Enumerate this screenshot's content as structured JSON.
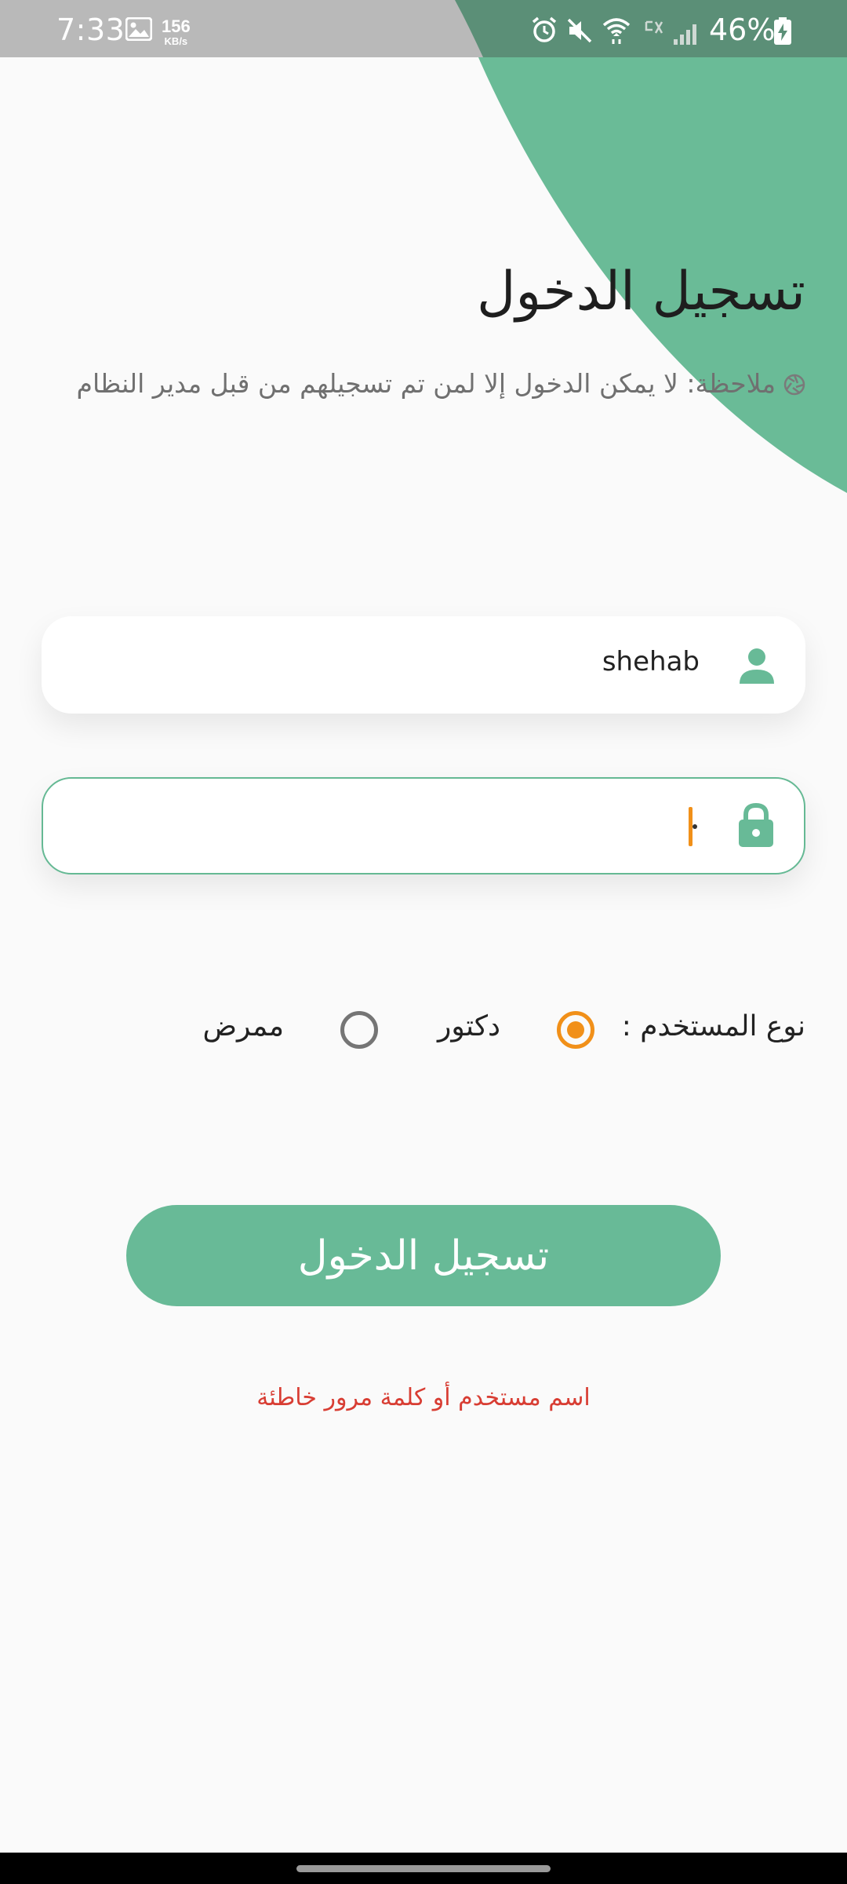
{
  "colors": {
    "accent": "#68ba97",
    "radio_selected": "#f19019",
    "error": "#d83d33",
    "background": "#fafafa"
  },
  "status_bar": {
    "time": "7:33",
    "net_speed_value": "156",
    "net_speed_unit": "KB/s",
    "battery": "46%",
    "icons": [
      "gallery-icon",
      "alarm-icon",
      "mute-icon",
      "wifi-icon",
      "data-off-icon",
      "signal-icon",
      "battery-charging-icon"
    ]
  },
  "header": {
    "title": "تسجيل الدخول",
    "note": "ملاحظة: لا يمكن الدخول إلا لمن تم تسجيلهم من قبل مدير النظام",
    "note_icon": "shutter-icon"
  },
  "form": {
    "username": {
      "value": "shehab",
      "icon": "person-icon"
    },
    "password": {
      "value": "",
      "icon": "lock-icon",
      "focused": true
    },
    "user_type": {
      "label": "نوع المستخدم :",
      "options": [
        {
          "label": "دكتور",
          "selected": true
        },
        {
          "label": "ممرض",
          "selected": false
        }
      ]
    },
    "submit_label": "تسجيل الدخول",
    "error_message": "اسم مستخدم أو كلمة مرور خاطئة"
  }
}
